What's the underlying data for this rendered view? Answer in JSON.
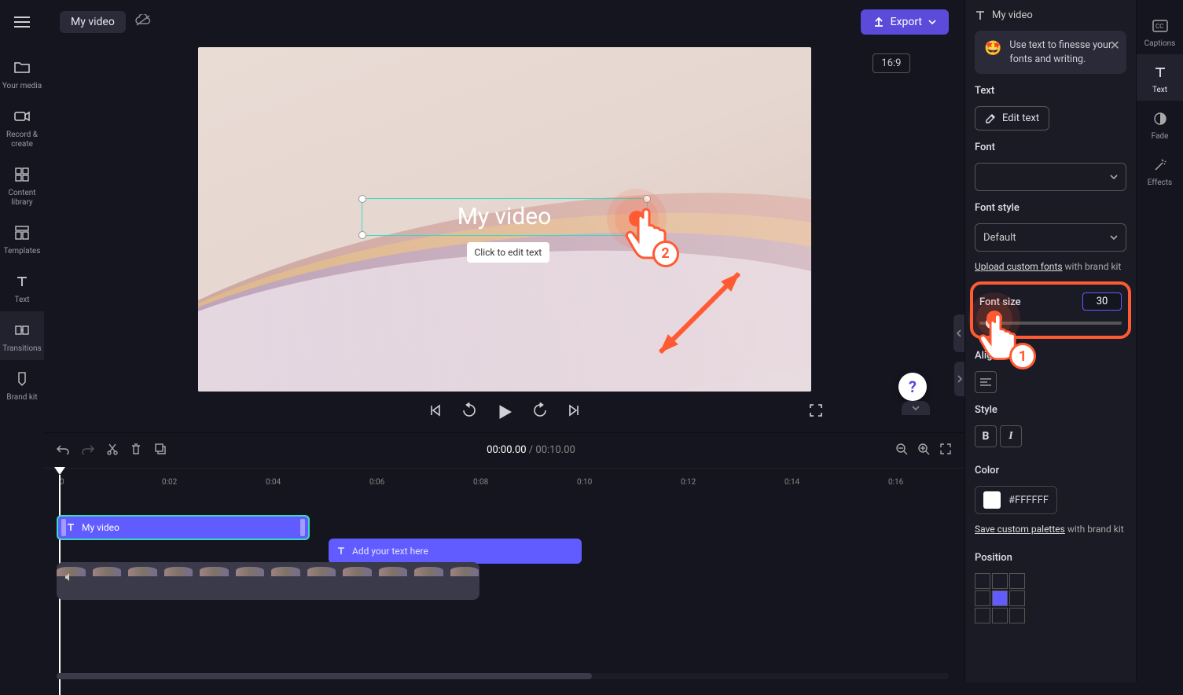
{
  "header": {
    "title": "My video",
    "export_label": "Export",
    "aspect_ratio": "16:9"
  },
  "left_nav": {
    "items": [
      {
        "label": "Your media"
      },
      {
        "label": "Record & create"
      },
      {
        "label": "Content library"
      },
      {
        "label": "Templates"
      },
      {
        "label": "Text"
      },
      {
        "label": "Transitions"
      },
      {
        "label": "Brand kit"
      }
    ]
  },
  "preview": {
    "text_overlay": "My video",
    "tooltip": "Click to edit text"
  },
  "tutorial": {
    "step1": "1",
    "step2": "2"
  },
  "timeline": {
    "current_time": "00:00.00",
    "separator": " / ",
    "total_time": "00:10.00",
    "ticks": [
      "0",
      "0:02",
      "0:04",
      "0:06",
      "0:08",
      "0:10",
      "0:12",
      "0:14",
      "0:16"
    ],
    "clips": {
      "text_selected": "My video",
      "text_placeholder": "Add your text here"
    }
  },
  "properties": {
    "panel_title": "My video",
    "tip_text": "Use text to finesse your fonts and writing.",
    "section_text": "Text",
    "edit_text_btn": "Edit text",
    "section_font": "Font",
    "font_value": "",
    "section_font_style": "Font style",
    "font_style_value": "Default",
    "upload_fonts_link": "Upload custom fonts",
    "upload_fonts_suffix": " with brand kit",
    "section_font_size": "Font size",
    "font_size_value": "30",
    "section_alignment": "Alignment",
    "section_style": "Style",
    "bold_label": "B",
    "italic_label": "I",
    "section_color": "Color",
    "color_hex": "#FFFFFF",
    "save_palettes_link": "Save custom palettes",
    "save_palettes_suffix": " with brand kit",
    "section_position": "Position"
  },
  "far_right": {
    "items": [
      {
        "label": "Captions"
      },
      {
        "label": "Text"
      },
      {
        "label": "Fade"
      },
      {
        "label": "Effects"
      }
    ]
  },
  "help_label": "?"
}
